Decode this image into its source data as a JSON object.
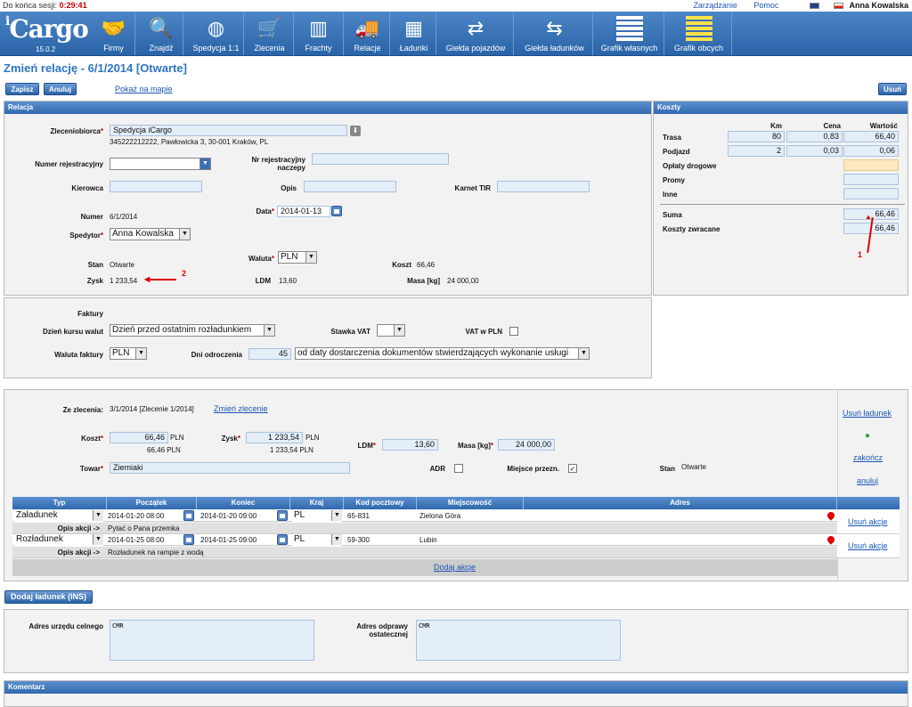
{
  "session": {
    "label": "Do końca sesji:",
    "time": "0:29:41"
  },
  "top": {
    "manage": "Zarządzanie",
    "help": "Pomoc",
    "user": "Anna Kowalska"
  },
  "logo": {
    "text": "Cargo",
    "version": "15.0.2"
  },
  "nav": [
    {
      "label": "Firmy",
      "icon": "handshake-icon",
      "glyph": "🤝"
    },
    {
      "label": "Znajdź",
      "icon": "search-icon",
      "glyph": "🔍"
    },
    {
      "label": "Spedycja 1:1",
      "icon": "globe-icon",
      "glyph": "◍"
    },
    {
      "label": "Zlecenia",
      "icon": "cart-icon",
      "glyph": "🛒"
    },
    {
      "label": "Frachty",
      "icon": "cart-boxes-icon",
      "glyph": "▥"
    },
    {
      "label": "Relacje",
      "icon": "truck-icon",
      "glyph": "🚚"
    },
    {
      "label": "Ładunki",
      "icon": "cargo-icon",
      "glyph": "▦"
    },
    {
      "label": "Giełda pojazdów",
      "icon": "vehicle-exchange-icon",
      "glyph": "⇄"
    },
    {
      "label": "Giełda ładunków",
      "icon": "cargo-exchange-icon",
      "glyph": "⇆"
    },
    {
      "label": "Grafik własnych",
      "icon": "schedule-own-icon",
      "glyph": "▤"
    },
    {
      "label": "Grafik obcych",
      "icon": "schedule-other-icon",
      "glyph": "▤"
    }
  ],
  "page": {
    "title": "Zmień relację - 6/1/2014 [Otwarte]"
  },
  "toolbar": {
    "save": "Zapisz",
    "cancel": "Anuluj",
    "map": "Pokaż na mapie",
    "delete": "Usuń"
  },
  "relacja": {
    "header": "Relacja",
    "recipient_label": "Zleceniobiorca",
    "recipient_value": "Spedycja iCargo",
    "recipient_addr": "345222212222, Pawłowicka 3, 30-001 Kraków, PL",
    "regnum_label": "Numer rejestracyjny",
    "trailer_label": "Nr rejestracyjny naczepy",
    "driver_label": "Kierowca",
    "desc_label": "Opis",
    "tir_label": "Karnet TIR",
    "number_label": "Numer",
    "number_value": "6/1/2014",
    "date_label": "Data",
    "date_value": "2014-01-13",
    "forwarder_label": "Spedytor",
    "forwarder_value": "Anna Kowalska",
    "status_label": "Stan",
    "status_value": "Otwarte",
    "currency_label": "Waluta",
    "currency_value": "PLN",
    "cost_label": "Koszt",
    "cost_value": "66,46",
    "profit_label": "Zysk",
    "profit_value": "1 233,54",
    "ldm_label": "LDM",
    "ldm_value": "13,60",
    "mass_label": "Masa [kg]",
    "mass_value": "24 000,00",
    "annotation2": "2"
  },
  "faktury": {
    "header": "Faktury",
    "rate_day_label": "Dzień kursu walut",
    "rate_day_value": "Dzień przed ostatnim rozładunkiem",
    "vat_label": "Stawka VAT",
    "vat_pln_label": "VAT w PLN",
    "inv_currency_label": "Waluta faktury",
    "inv_currency_value": "PLN",
    "due_label": "Dni odroczenia",
    "due_value": "45",
    "due_from": "od daty dostarczenia dokumentów stwierdzających wykonanie usługi"
  },
  "koszty": {
    "header": "Koszty",
    "cols": [
      "Km",
      "Cena",
      "Wartość"
    ],
    "trasa": {
      "label": "Trasa",
      "km": "80",
      "price": "0,83",
      "value": "66,40"
    },
    "podjazd": {
      "label": "Podjazd",
      "km": "2",
      "price": "0,03",
      "value": "0,06"
    },
    "tolls": "Opłaty drogowe",
    "ferries": "Promy",
    "other": "Inne",
    "sum_label": "Suma",
    "sum_value": "66,46",
    "refund_label": "Koszty zwracane",
    "refund_value": "66,46",
    "annotation1": "1"
  },
  "cargo": {
    "from_label": "Ze zlecenia:",
    "from_value": "3/1/2014 [Zlecenie 1/2014]",
    "change_order": "Zmień zlecenie",
    "remove": "Usuń ładunek",
    "finish": "zakończ",
    "cancel": "anuluj",
    "cost_label": "Koszt",
    "cost_value": "66,46",
    "cost_cur": "PLN",
    "cost2": "66,46 PLN",
    "profit_label": "Zysk",
    "profit_value": "1 233,54",
    "profit_cur": "PLN",
    "profit2": "1 233,54 PLN",
    "ldm_label": "LDM",
    "ldm_value": "13,60",
    "mass_label": "Masa [kg]",
    "mass_value": "24 000,00",
    "goods_label": "Towar",
    "goods_value": "Ziemiaki",
    "adr_label": "ADR",
    "place_label": "Miejsce przezn.",
    "status_label": "Stan",
    "status_value": "Otwarte",
    "table_headers": [
      "Typ",
      "Początek",
      "Koniec",
      "Kraj",
      "Kod pocztowy",
      "Miejscowość",
      "Adres"
    ],
    "rows": [
      {
        "type": "Załadunek",
        "start": "2014-01-20 08:00",
        "end": "2014-01-20 09:00",
        "country": "PL",
        "zip": "65-831",
        "city": "Zielona Góra",
        "remove": "Usuń akcje",
        "desc_label": "Opis akcji ->",
        "desc": "Pytać o Pana przemka"
      },
      {
        "type": "Rozładunek",
        "start": "2014-01-25 08:00",
        "end": "2014-01-25 09:00",
        "country": "PL",
        "zip": "59-300",
        "city": "Lubin",
        "remove": "Usuń akcje",
        "desc_label": "Opis akcji ->",
        "desc": "Rozładunek na rampie z wodą"
      }
    ],
    "add_action": "Dodaj akcje"
  },
  "add_cargo": "Dodaj ładunek (INS)",
  "customs": {
    "office_label": "Adres urzędu celnego",
    "office_value": "CMR",
    "final_label": "Adres odprawy ostatecznej",
    "final_value": "CMR"
  },
  "comment": {
    "header": "Komentarz"
  }
}
